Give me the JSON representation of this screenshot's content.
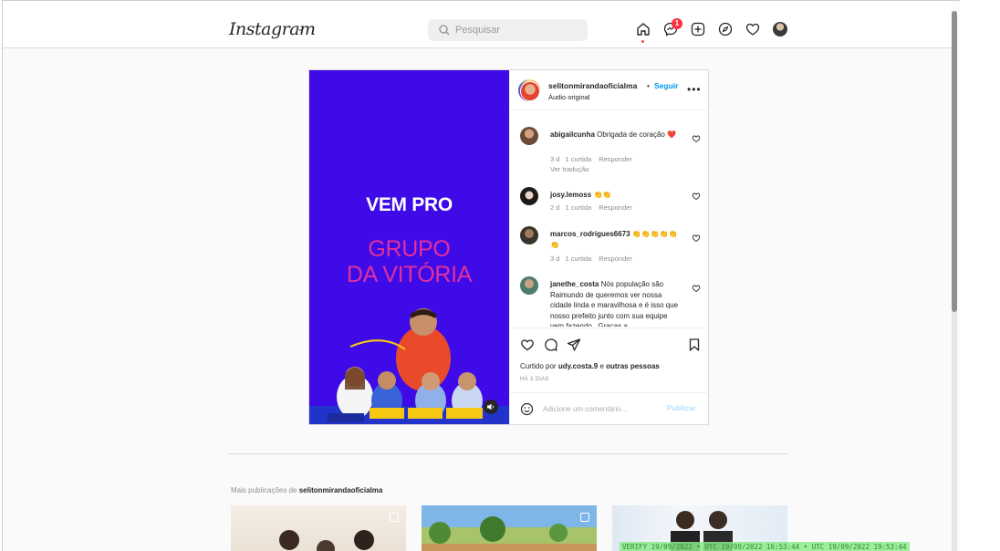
{
  "topnav": {
    "logo": "Instagram",
    "logo_chevron": "⌄",
    "search_placeholder": "Pesquisar",
    "messages_badge": "1",
    "icons": [
      "home-icon",
      "messenger-icon",
      "new-post-icon",
      "explore-icon",
      "activity-heart-icon",
      "profile-avatar"
    ]
  },
  "post": {
    "media": {
      "headline": "VEM PRO",
      "subline_1": "GRUPO",
      "subline_2": "DA VITÓRIA",
      "background": "#3f0ae8",
      "accent": "#e2309b"
    },
    "author": {
      "username": "selitonmirandaoficialma",
      "separator": "•",
      "follow_label": "Seguir",
      "audio": "Áudio original",
      "more": "•••"
    },
    "comments": [
      {
        "username": "abigailcunha",
        "text": "Obrigada de coração ❤️",
        "age": "3 d",
        "likes": "1 curtida",
        "reply": "Responder",
        "translate": "Ver tradução"
      },
      {
        "username": "josy.lemoss",
        "text": "👏👏",
        "age": "2 d",
        "likes": "1 curtida",
        "reply": "Responder"
      },
      {
        "username": "marcos_rodrigues6673",
        "text": "👏👏👏👏👏👏",
        "age": "3 d",
        "likes": "1 curtida",
        "reply": "Responder"
      },
      {
        "username": "janethe_costa",
        "text": "Nós população são Raimundo de queremos ver nossa cidade linda e maravilhosa e é isso que nosso prefeito junto com sua equipe vem fazendo . Graças a"
      }
    ],
    "liked_by_prefix": "Curtido por",
    "liked_by_user": "udy.costa.9",
    "liked_by_joiner": "e",
    "liked_by_others": "outras pessoas",
    "posted_ago": "HÁ 3 DIAS",
    "add_comment_placeholder": "Adicione um comentário...",
    "publish_label": "Publicar"
  },
  "more_posts": {
    "prefix": "Mais publicações de",
    "username": "selitonmirandaoficialma"
  },
  "overlay_stamp": "VERIFY 19/09/2022 • UTC 19/09/2022 16:53:44 • UTC 19/09/2022 19:53:44"
}
